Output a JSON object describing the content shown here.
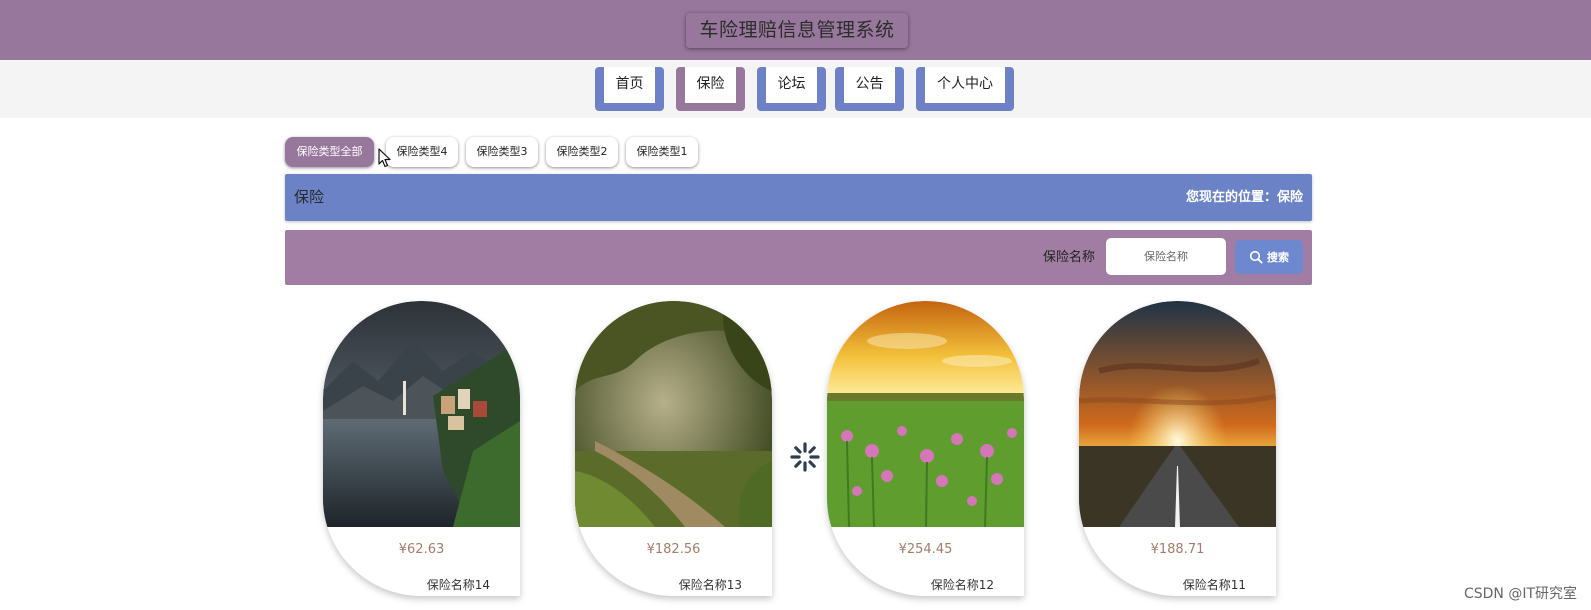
{
  "header": {
    "title": "车险理赔信息管理系统"
  },
  "nav": {
    "items": [
      {
        "label": "首页"
      },
      {
        "label": "保险"
      },
      {
        "label": "论坛"
      },
      {
        "label": "公告"
      },
      {
        "label": "个人中心"
      }
    ],
    "active_label": "保险"
  },
  "categories": {
    "items": [
      {
        "label": "保险类型全部"
      },
      {
        "label": "保险类型4"
      },
      {
        "label": "保险类型3"
      },
      {
        "label": "保险类型2"
      },
      {
        "label": "保险类型1"
      }
    ],
    "active_label": "保险类型全部"
  },
  "section": {
    "title": "保险",
    "breadcrumb": "您现在的位置：保险"
  },
  "search": {
    "label": "保险名称",
    "placeholder": "保险名称",
    "value": "",
    "button_label": "搜索",
    "button_icon": "search-icon"
  },
  "products": [
    {
      "price": "¥62.63",
      "name": "保险名称14",
      "image": "lakeside-village-photo"
    },
    {
      "price": "¥182.56",
      "name": "保险名称13",
      "image": "forest-path-photo"
    },
    {
      "price": "¥254.45",
      "name": "保险名称12",
      "image": "sunset-flower-field-photo"
    },
    {
      "price": "¥188.71",
      "name": "保险名称11",
      "image": "sunset-road-photo"
    }
  ],
  "watermark": "CSDN @IT研究室",
  "colors": {
    "header": "#98779c",
    "nav_accent": "#6e80c6",
    "nav_active": "#98779c",
    "section_bar": "#6b83c6",
    "search_bar": "#a17da3",
    "search_button": "#6e88cf",
    "price": "#a57c6a"
  }
}
